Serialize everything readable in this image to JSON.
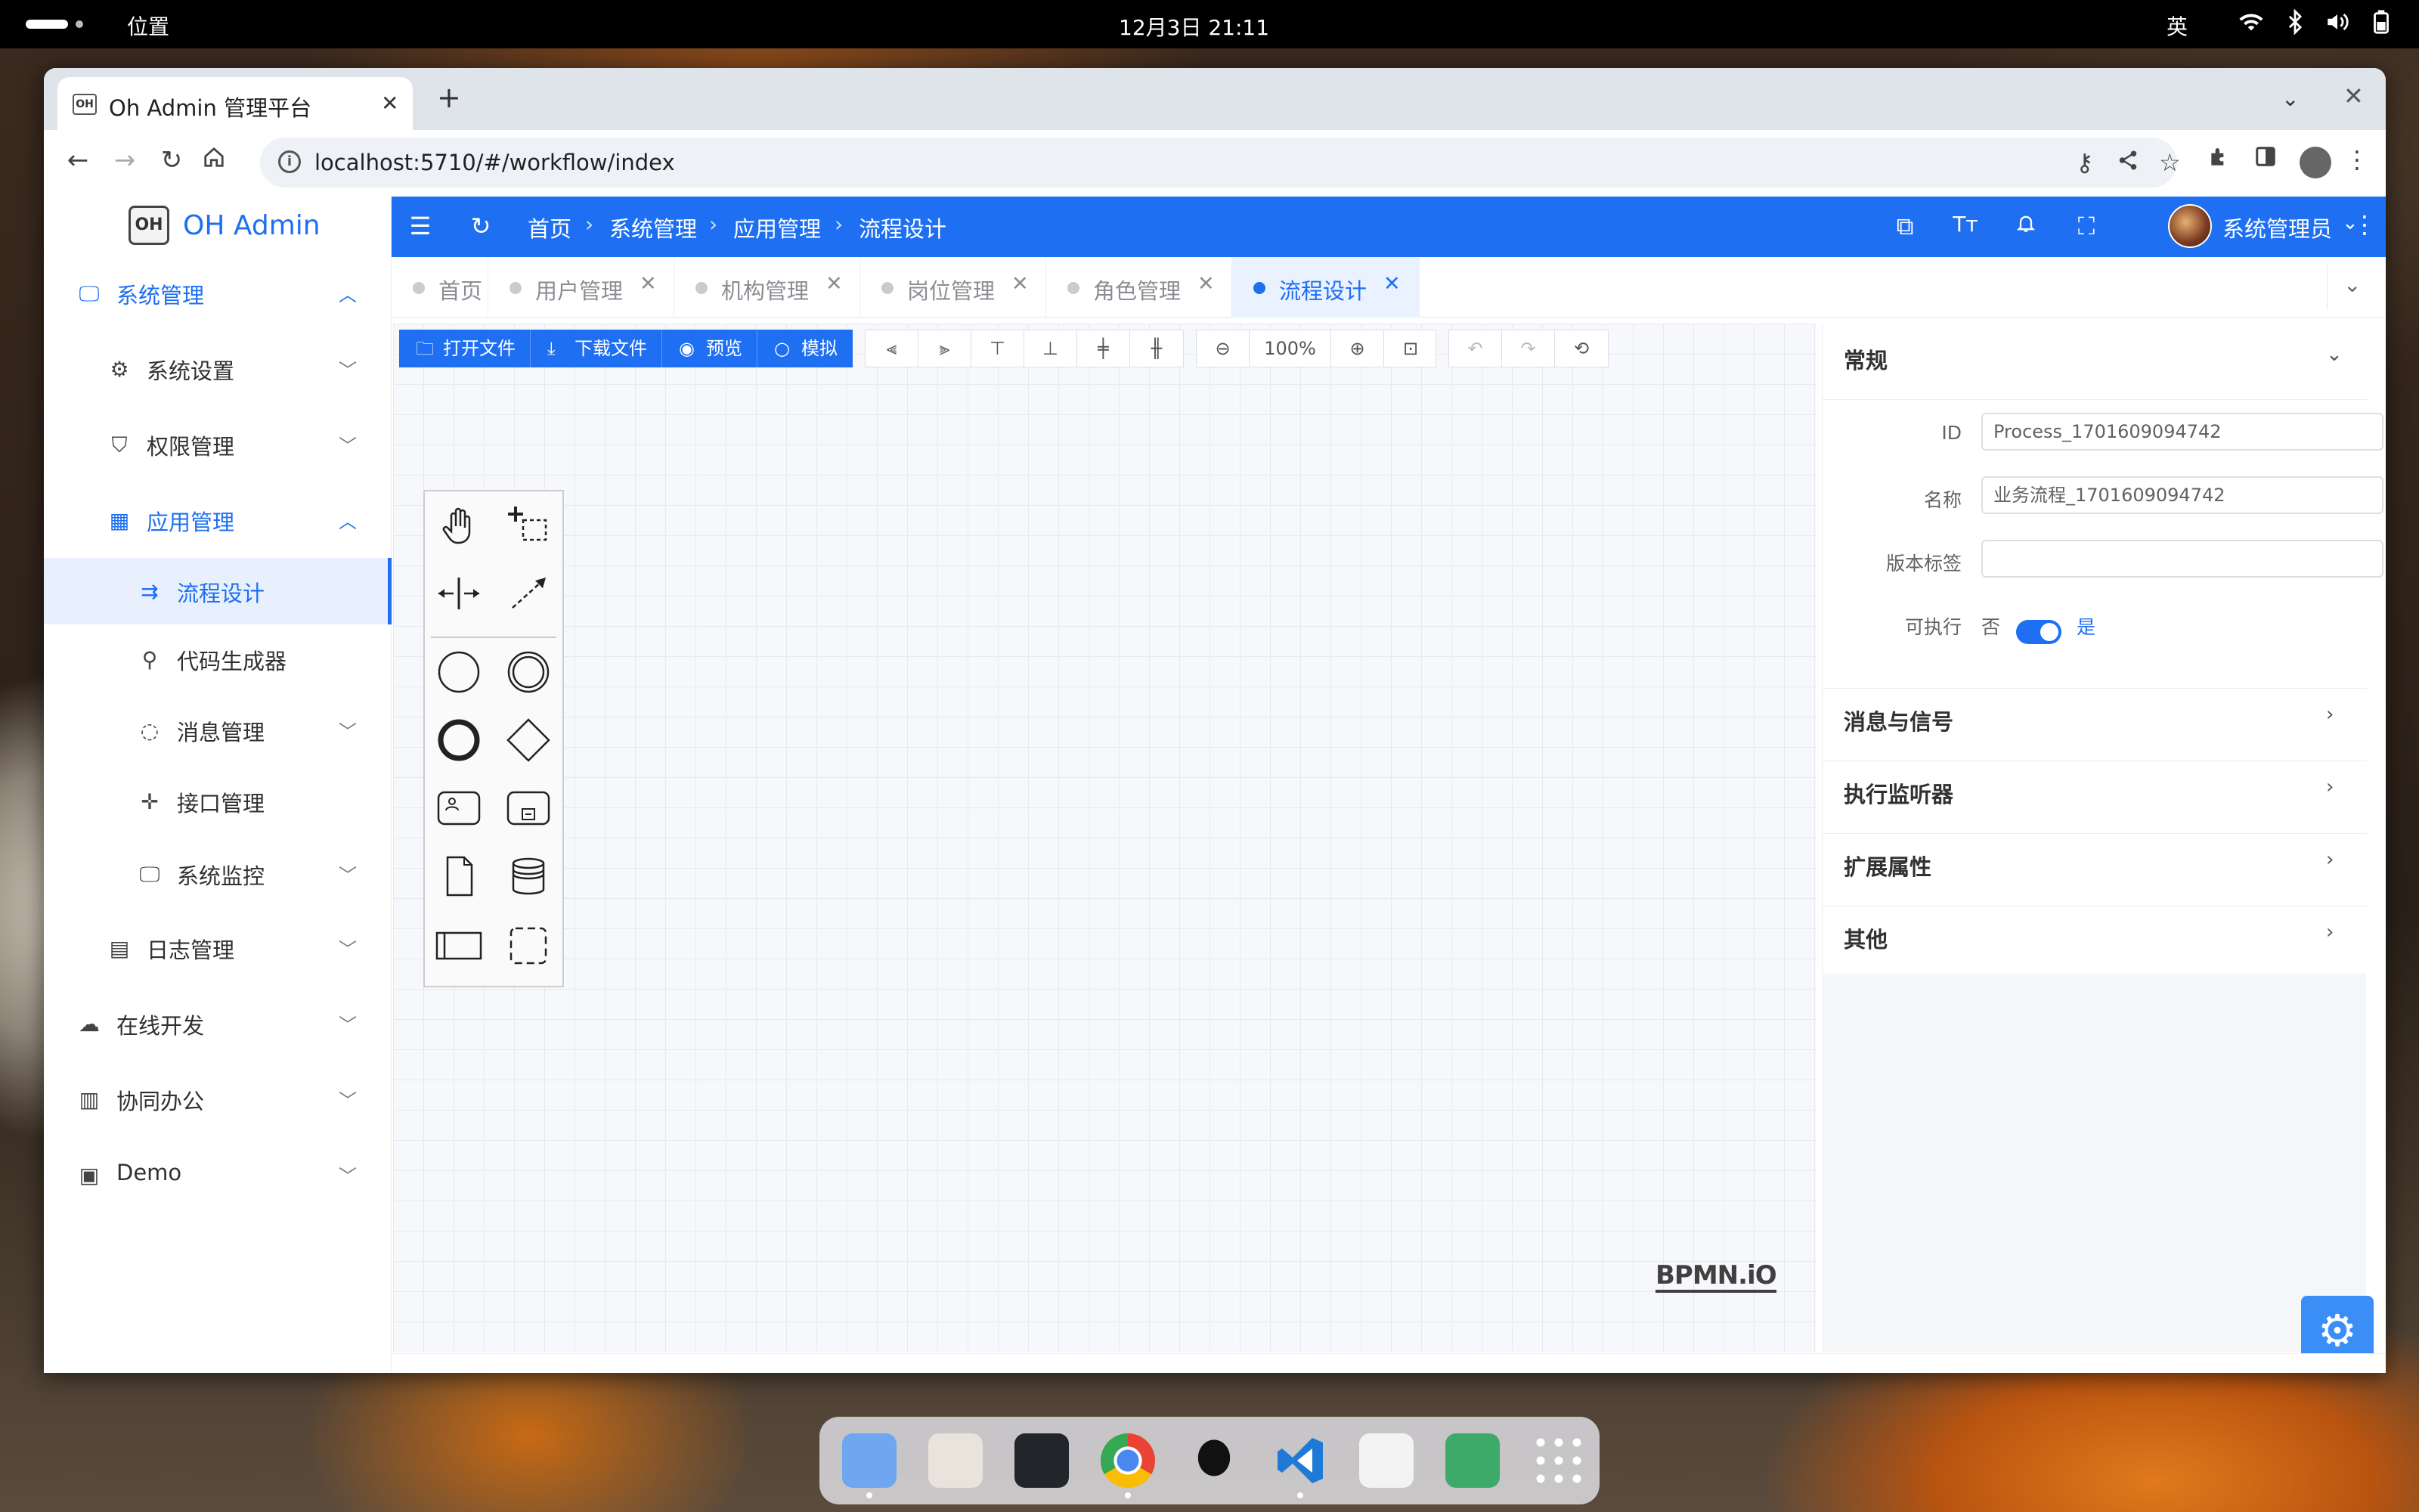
{
  "system_bar": {
    "app_menu": "位置",
    "clock": "12月3日  21:11",
    "ime": "英"
  },
  "browser": {
    "tab_title": "Oh Admin 管理平台",
    "favicon_text": "OH",
    "url": "localhost:5710/#/workflow/index"
  },
  "sidebar": {
    "logo_text": "OH Admin",
    "logo_badge": "OH",
    "items": [
      {
        "label": "系统管理",
        "icon": "monitor-icon",
        "arrow": "chevron-up-icon"
      },
      {
        "label": "系统设置",
        "icon": "gear-icon",
        "arrow": "chevron-down-icon"
      },
      {
        "label": "权限管理",
        "icon": "shield-icon",
        "arrow": "chevron-down-icon"
      },
      {
        "label": "应用管理",
        "icon": "grid-icon",
        "arrow": "chevron-up-icon"
      },
      {
        "label": "流程设计",
        "icon": "flow-icon"
      },
      {
        "label": "代码生成器",
        "icon": "rocket-icon"
      },
      {
        "label": "消息管理",
        "icon": "chat-icon",
        "arrow": "chevron-down-icon"
      },
      {
        "label": "接口管理",
        "icon": "move-icon"
      },
      {
        "label": "系统监控",
        "icon": "monitor-chart-icon",
        "arrow": "chevron-down-icon"
      },
      {
        "label": "日志管理",
        "icon": "log-icon",
        "arrow": "chevron-down-icon"
      },
      {
        "label": "在线开发",
        "icon": "cloud-icon",
        "arrow": "chevron-down-icon"
      },
      {
        "label": "协同办公",
        "icon": "building-icon",
        "arrow": "chevron-down-icon"
      },
      {
        "label": "Demo",
        "icon": "dashboard-icon",
        "arrow": "chevron-down-icon"
      }
    ]
  },
  "header": {
    "breadcrumb": [
      "首页",
      "系统管理",
      "应用管理",
      "流程设计"
    ],
    "user_name": "系统管理员"
  },
  "tags": [
    {
      "label": "首页",
      "closable": false
    },
    {
      "label": "用户管理",
      "closable": true
    },
    {
      "label": "机构管理",
      "closable": true
    },
    {
      "label": "岗位管理",
      "closable": true
    },
    {
      "label": "角色管理",
      "closable": true
    },
    {
      "label": "流程设计",
      "closable": true,
      "active": true
    }
  ],
  "modeler": {
    "buttons": [
      "打开文件",
      "下载文件",
      "预览",
      "模拟"
    ],
    "zoom": "100%",
    "watermark": "BPMN.iO"
  },
  "properties": {
    "general_title": "常规",
    "fields": [
      {
        "label": "ID",
        "value": "Process_1701609094742"
      },
      {
        "label": "名称",
        "value": "业务流程_1701609094742"
      },
      {
        "label": "版本标签",
        "value": ""
      }
    ],
    "executable": {
      "label": "可执行",
      "off_text": "否",
      "on_text": "是",
      "value": true
    },
    "sections": [
      "消息与信号",
      "执行监听器",
      "扩展属性",
      "其他"
    ]
  },
  "colors": {
    "primary": "#1e6ff2",
    "header_bg": "#1e6ff2",
    "active_tag_bg": "#eaf2ff"
  }
}
